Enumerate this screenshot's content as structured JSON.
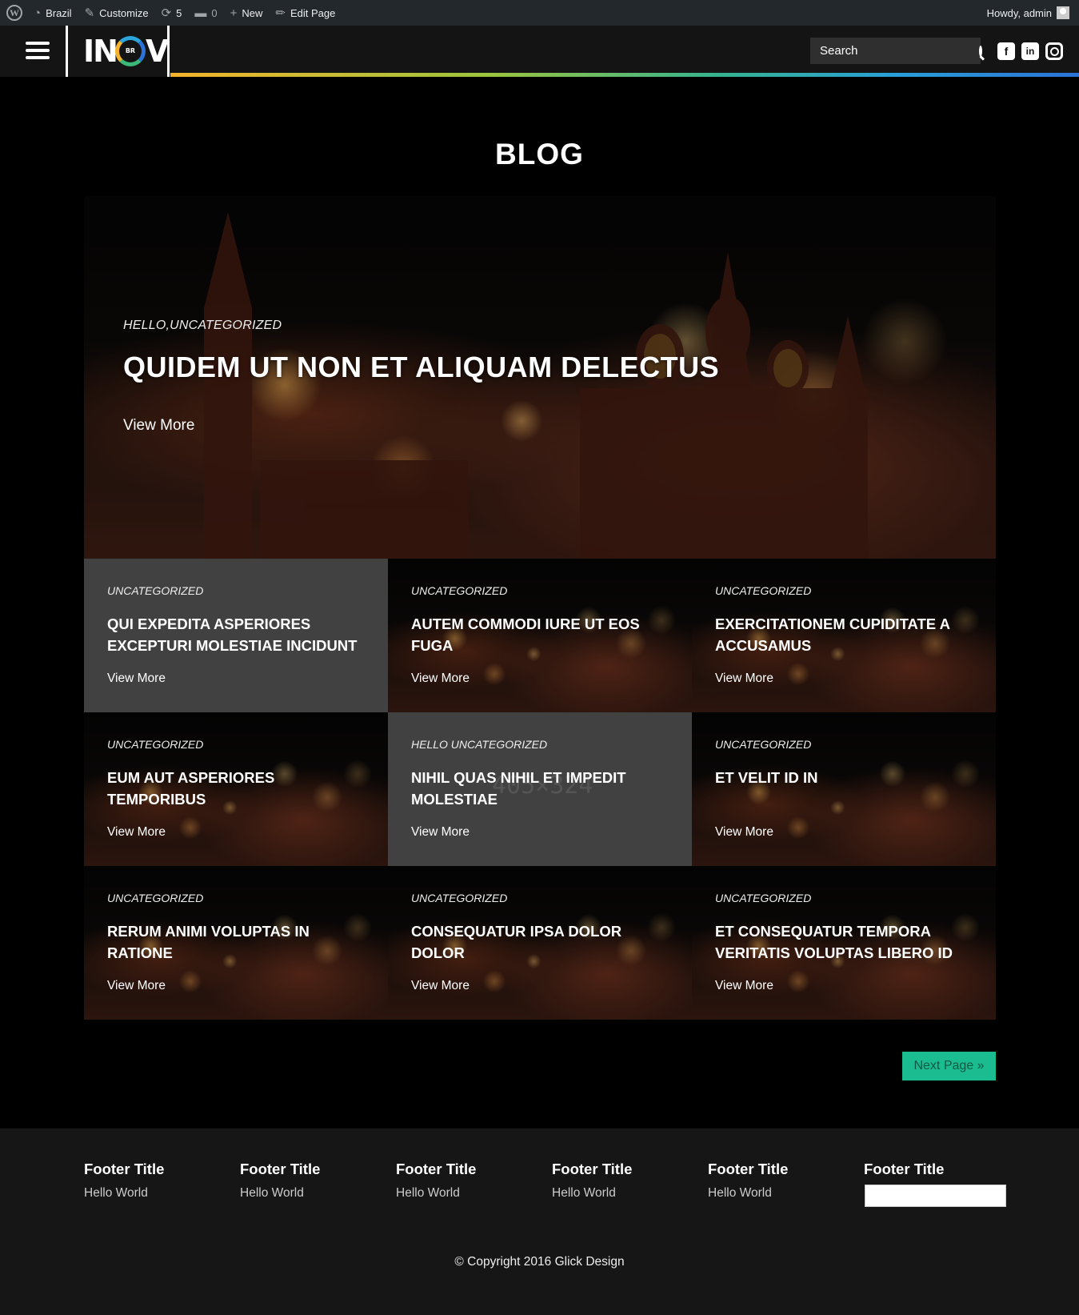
{
  "admin_bar": {
    "wp_logo": "W",
    "site_name": "Brazil",
    "customize": "Customize",
    "updates_count": "5",
    "comments_count": "0",
    "new": "New",
    "edit_page": "Edit Page",
    "howdy": "Howdy, admin"
  },
  "header": {
    "logo_left": "IN",
    "logo_ring": "BR",
    "logo_right": "V",
    "search_placeholder": "Search",
    "social": {
      "facebook": "f",
      "linkedin": "in"
    }
  },
  "page_title": "BLOG",
  "hero": {
    "category": "HELLO,UNCATEGORIZED",
    "title": "QUIDEM UT NON ET ALIQUAM DELECTUS",
    "cta": "View More"
  },
  "posts": [
    {
      "category": "UNCATEGORIZED",
      "title": "QUI EXPEDITA ASPERIORES EXCEPTURI MOLESTIAE INCIDUNT",
      "cta": "View More"
    },
    {
      "category": "UNCATEGORIZED",
      "title": "AUTEM COMMODI IURE UT EOS FUGA",
      "cta": "View More"
    },
    {
      "category": "UNCATEGORIZED",
      "title": "EXERCITATIONEM CUPIDITATE A ACCUSAMUS",
      "cta": "View More"
    },
    {
      "category": "UNCATEGORIZED",
      "title": "EUM AUT ASPERIORES TEMPORIBUS",
      "cta": "View More"
    },
    {
      "category": "HELLO UNCATEGORIZED",
      "title": "NIHIL QUAS NIHIL ET IMPEDIT MOLESTIAE",
      "cta": "View More",
      "placeholder": "405×324"
    },
    {
      "category": "UNCATEGORIZED",
      "title": "ET VELIT ID IN",
      "cta": "View More"
    },
    {
      "category": "UNCATEGORIZED",
      "title": "RERUM ANIMI VOLUPTAS IN RATIONE",
      "cta": "View More"
    },
    {
      "category": "UNCATEGORIZED",
      "title": "CONSEQUATUR IPSA DOLOR DOLOR",
      "cta": "View More"
    },
    {
      "category": "UNCATEGORIZED",
      "title": "ET CONSEQUATUR TEMPORA VERITATIS VOLUPTAS LIBERO ID",
      "cta": "View More"
    }
  ],
  "pagination": {
    "next": "Next Page »"
  },
  "footer": {
    "columns": [
      {
        "title": "Footer Title",
        "link": "Hello World"
      },
      {
        "title": "Footer Title",
        "link": "Hello World"
      },
      {
        "title": "Footer Title",
        "link": "Hello World"
      },
      {
        "title": "Footer Title",
        "link": "Hello World"
      },
      {
        "title": "Footer Title",
        "link": "Hello World"
      },
      {
        "title": "Footer Title"
      }
    ],
    "copyright": "© Copyright 2016 Glick Design"
  },
  "colors": {
    "accent": "#1bbc8f",
    "header_bg": "#141414",
    "admin_bar": "#23282d",
    "card_grey": "#414141",
    "footer_bg": "#161616"
  }
}
